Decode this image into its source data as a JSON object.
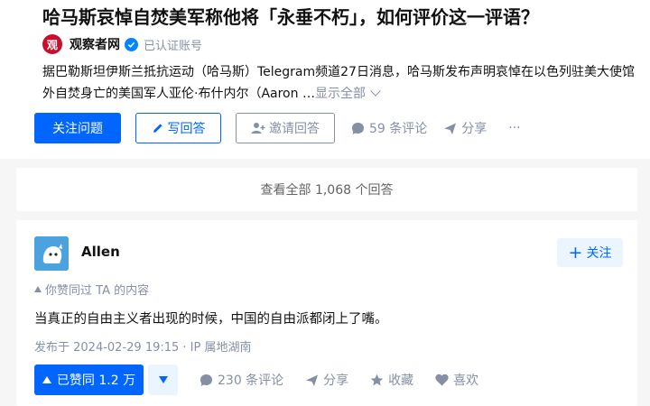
{
  "question": {
    "title": "哈马斯哀悼自焚美军称他将「永垂不朽」，如何评价这一评语？",
    "author": {
      "avatar_text": "观",
      "name": "观察者网",
      "verified_label": "已认证账号"
    },
    "excerpt": "据巴勒斯坦伊斯兰抵抗运动（哈马斯）Telegram频道27日消息，哈马斯发布声明哀悼在以色列驻美大使馆外自焚身亡的美国军人亚伦·布什内尔（Aaron …",
    "show_all": "显示全部",
    "actions": {
      "follow": "关注问题",
      "write_answer": "写回答",
      "invite": "邀请回答",
      "comments": "59 条评论",
      "share": "分享",
      "more": "···"
    }
  },
  "view_all_answers": "查看全部 1,068 个回答",
  "answer": {
    "author_name": "Allen",
    "follow_label": "关注",
    "agree_hint": "你赞同过 TA 的内容",
    "content": "当真正的自由主义者出现的时候，中国的自由派都闭上了嘴。",
    "meta": "发布于 2024-02-29 19:15 · IP 属地湖南",
    "actions": {
      "vote_up": "已赞同 1.2 万",
      "comments": "230 条评论",
      "share": "分享",
      "collect": "收藏",
      "like": "喜欢"
    }
  },
  "colors": {
    "brand": "#0066ff",
    "muted": "#8590a6",
    "verified": "#0084ff",
    "avatar_red": "#c8102e"
  },
  "icons": [
    "edit-icon",
    "add-person-icon",
    "comment-icon",
    "share-icon",
    "more-icon",
    "verified-icon",
    "heart-icon",
    "star-icon",
    "plus-icon"
  ]
}
